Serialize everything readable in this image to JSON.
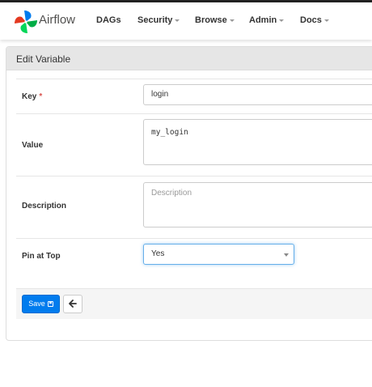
{
  "navbar": {
    "brand": "Airflow",
    "items": [
      {
        "label": "DAGs"
      },
      {
        "label": "Security"
      },
      {
        "label": "Browse"
      },
      {
        "label": "Admin"
      },
      {
        "label": "Docs"
      }
    ]
  },
  "panel": {
    "title": "Edit Variable"
  },
  "form": {
    "key": {
      "label": "Key",
      "required_mark": "*",
      "value": "login"
    },
    "value": {
      "label": "Value",
      "value": "my_login"
    },
    "description": {
      "label": "Description",
      "placeholder": "Description",
      "value": ""
    },
    "pin": {
      "label": "Pin at Top",
      "selected": "Yes"
    }
  },
  "actions": {
    "save_label": "Save",
    "back_icon": "arrow-left-icon",
    "save_icon": "floppy-disk-icon"
  },
  "colors": {
    "primary": "#017cee",
    "required": "#d9534f",
    "focus": "#66afe9"
  }
}
